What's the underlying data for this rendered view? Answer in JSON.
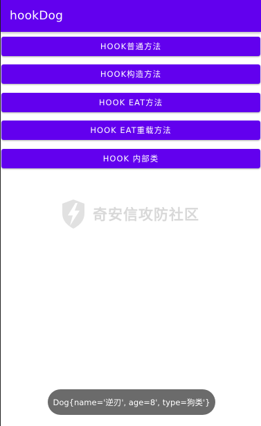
{
  "app_bar": {
    "title": "hookDog",
    "color": "#6200EE"
  },
  "buttons": [
    {
      "label": "HOOK普通方法"
    },
    {
      "label": "HOOK构造方法"
    },
    {
      "label": "HOOK EAT方法"
    },
    {
      "label": "HOOK EAT重载方法"
    },
    {
      "label": "HOOK 内部类"
    }
  ],
  "watermark": {
    "text": "奇安信攻防社区",
    "icon": "shield-logo-icon"
  },
  "toast": {
    "message": "Dog{name='逆刃', age=8', type=狗类'}"
  }
}
